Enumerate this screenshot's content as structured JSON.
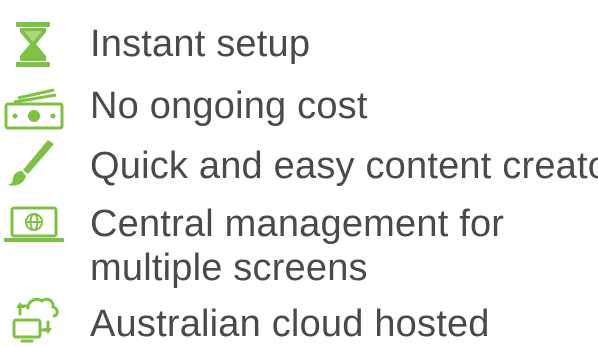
{
  "colors": {
    "accent": "#7dc242",
    "text": "#4a4a4a"
  },
  "features": [
    {
      "icon": "hourglass-icon",
      "label": "Instant setup"
    },
    {
      "icon": "money-stack-icon",
      "label": "No ongoing cost"
    },
    {
      "icon": "paintbrush-icon",
      "label": "Quick and easy content creator"
    },
    {
      "icon": "laptop-globe-icon",
      "label_line1": "Central management for",
      "label_line2": "multiple screens"
    },
    {
      "icon": "cloud-sync-icon",
      "label": "Australian cloud hosted"
    }
  ]
}
